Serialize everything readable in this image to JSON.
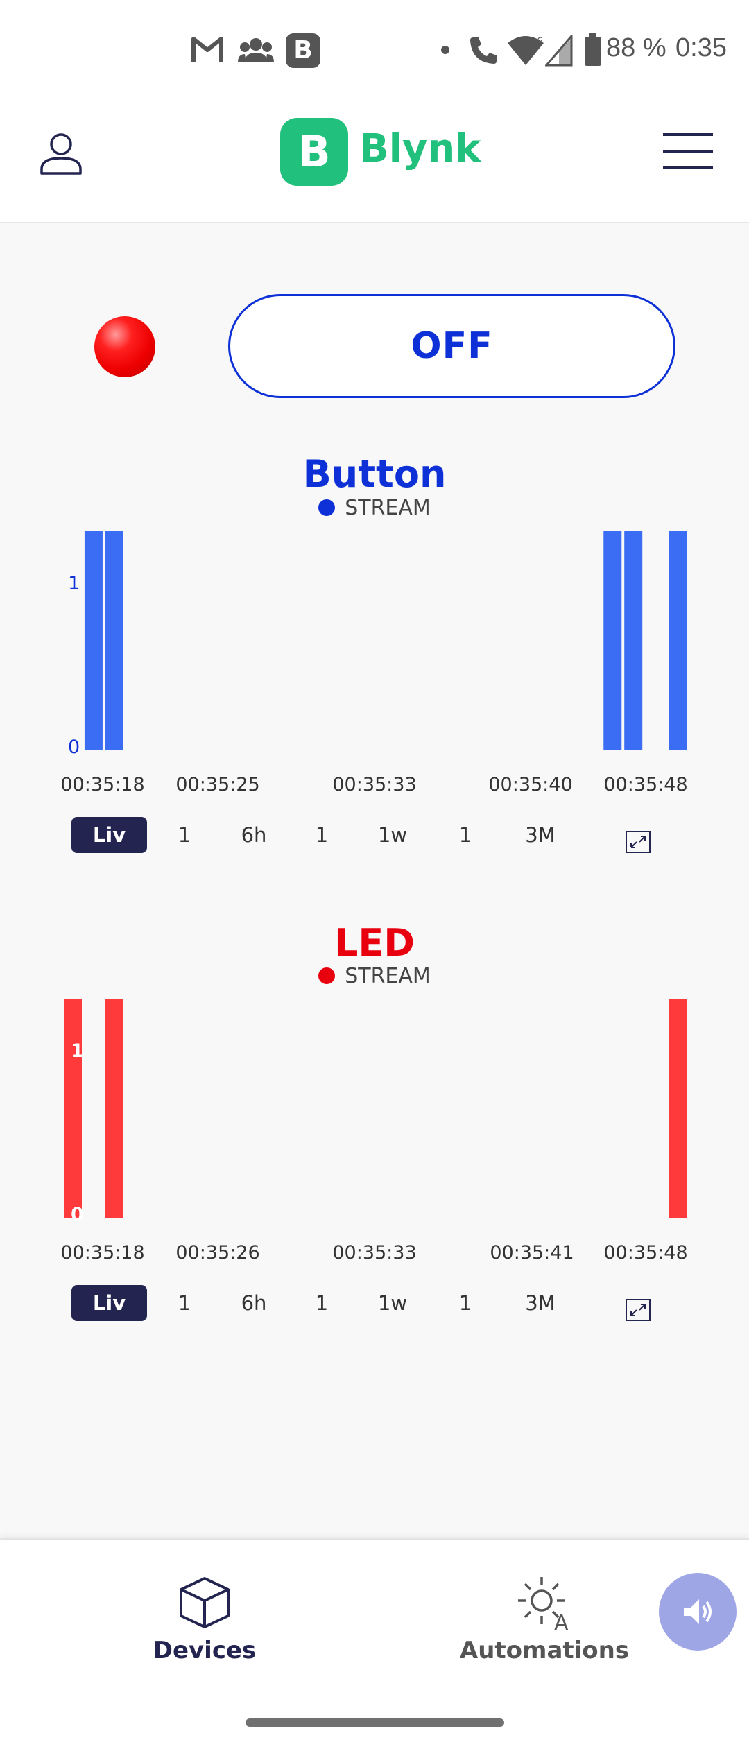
{
  "status_bar": {
    "battery": "88 %",
    "time": "0:35"
  },
  "header": {
    "brand_letter": "B",
    "brand_name": "Blynk"
  },
  "control": {
    "toggle_label": "OFF",
    "led_color": "#ff0000"
  },
  "charts": [
    {
      "title": "Button",
      "color": "#0d31d6",
      "bar_color": "#3a6cf4",
      "legend": "STREAM",
      "y_ticks": [
        "1",
        "0"
      ],
      "x_ticks": [
        "00:35:18",
        "00:35:25",
        "00:35:33",
        "00:35:40",
        "00:35:48"
      ],
      "ranges": [
        "Liv",
        "1",
        "6h",
        "1",
        "1w",
        "1",
        "3M"
      ]
    },
    {
      "title": "LED",
      "color": "#e8000f",
      "bar_color": "#ff3a3a",
      "legend": "STREAM",
      "y_ticks": [
        "1",
        "0"
      ],
      "x_ticks": [
        "00:35:18",
        "00:35:26",
        "00:35:33",
        "00:35:41",
        "00:35:48"
      ],
      "ranges": [
        "Liv",
        "1",
        "6h",
        "1",
        "1w",
        "1",
        "3M"
      ]
    }
  ],
  "chart_data": [
    {
      "type": "bar",
      "title": "Button",
      "legend": [
        "STREAM"
      ],
      "ylim": [
        0,
        1
      ],
      "x_ticks": [
        "00:35:18",
        "00:35:25",
        "00:35:33",
        "00:35:40",
        "00:35:48"
      ],
      "series": [
        {
          "name": "STREAM",
          "x": [
            "00:35:19",
            "00:35:20",
            "00:35:44",
            "00:35:45",
            "00:35:48"
          ],
          "values": [
            1,
            1,
            1,
            1,
            1
          ]
        }
      ]
    },
    {
      "type": "bar",
      "title": "LED",
      "legend": [
        "STREAM"
      ],
      "ylim": [
        0,
        1
      ],
      "x_ticks": [
        "00:35:18",
        "00:35:26",
        "00:35:33",
        "00:35:41",
        "00:35:48"
      ],
      "series": [
        {
          "name": "STREAM",
          "x": [
            "00:35:18",
            "00:35:20",
            "00:35:48"
          ],
          "values": [
            1,
            1,
            1
          ]
        }
      ]
    }
  ],
  "bottom_nav": {
    "items": [
      {
        "label": "Devices",
        "icon": "cube-icon",
        "active": true
      },
      {
        "label": "Automations",
        "icon": "sun-automation-icon",
        "active": false
      }
    ]
  }
}
